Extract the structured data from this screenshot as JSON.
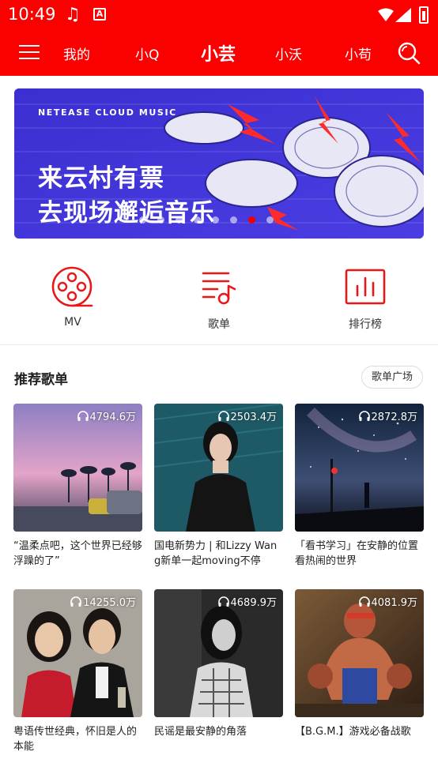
{
  "status": {
    "time": "10:49",
    "app_badge": "A"
  },
  "toolbar": {
    "tabs": [
      {
        "label": "我的",
        "active": false
      },
      {
        "label": "小Q",
        "active": false
      },
      {
        "label": "小芸",
        "active": true
      },
      {
        "label": "小沃",
        "active": false
      },
      {
        "label": "小苟",
        "active": false
      }
    ]
  },
  "banner": {
    "brand": "NETEASE CLOUD MUSIC",
    "line1": "来云村有票",
    "line2": "去现场邂逅音乐",
    "page_count": 8,
    "active_index": 6
  },
  "shortcuts": [
    {
      "label": "MV",
      "icon": "film-reel-icon"
    },
    {
      "label": "歌单",
      "icon": "playlist-icon"
    },
    {
      "label": "排行榜",
      "icon": "chart-icon"
    }
  ],
  "section": {
    "title": "推荐歌单",
    "plaza_label": "歌单广场"
  },
  "playlists": [
    {
      "count": "4794.6万",
      "title": "“温柔点吧，这个世界已经够浮躁的了”"
    },
    {
      "count": "2503.4万",
      "title": "国电新势力 | 和Lizzy Wang新单一起moving不停"
    },
    {
      "count": "2872.8万",
      "title": "「看书学习」在安静的位置看热闹的世界"
    },
    {
      "count": "14255.0万",
      "title": "粤语传世经典，怀旧是人的本能"
    },
    {
      "count": "4689.9万",
      "title": "民谣是最安静的角落"
    },
    {
      "count": "4081.9万",
      "title": "【B.G.M.】游戏必备战歌"
    }
  ],
  "colors": {
    "brand_red": "#fb0000",
    "accent": "#e81818"
  }
}
